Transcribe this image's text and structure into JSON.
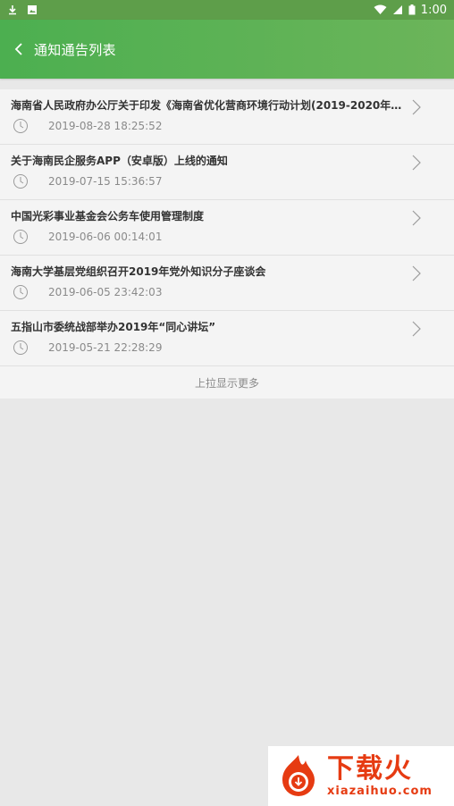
{
  "status_bar": {
    "time": "1:00",
    "icons": [
      "download-icon",
      "image-icon",
      "wifi-icon",
      "signal-icon",
      "battery-icon"
    ]
  },
  "header": {
    "title": "通知通告列表",
    "back_icon": "chevron-left-icon"
  },
  "list": {
    "items": [
      {
        "title": "海南省人民政府办公厅关于印发《海南省优化营商环境行动计划(2019-2020年)》...",
        "time": "2019-08-28 18:25:52"
      },
      {
        "title": "关于海南民企服务APP（安卓版）上线的通知",
        "time": "2019-07-15 15:36:57"
      },
      {
        "title": "中国光彩事业基金会公务车使用管理制度",
        "time": "2019-06-06 00:14:01"
      },
      {
        "title": "海南大学基层党组织召开2019年党外知识分子座谈会",
        "time": "2019-06-05 23:42:03"
      },
      {
        "title": "五指山市委统战部举办2019年“同心讲坛”",
        "time": "2019-05-21 22:28:29"
      }
    ],
    "load_more": "上拉显示更多"
  },
  "watermark": {
    "cn": "下载火",
    "en": "xiazaihuo.com"
  },
  "colors": {
    "header_green": "#4caf50",
    "background": "#e8e8e8",
    "watermark_red": "#e63b12"
  }
}
